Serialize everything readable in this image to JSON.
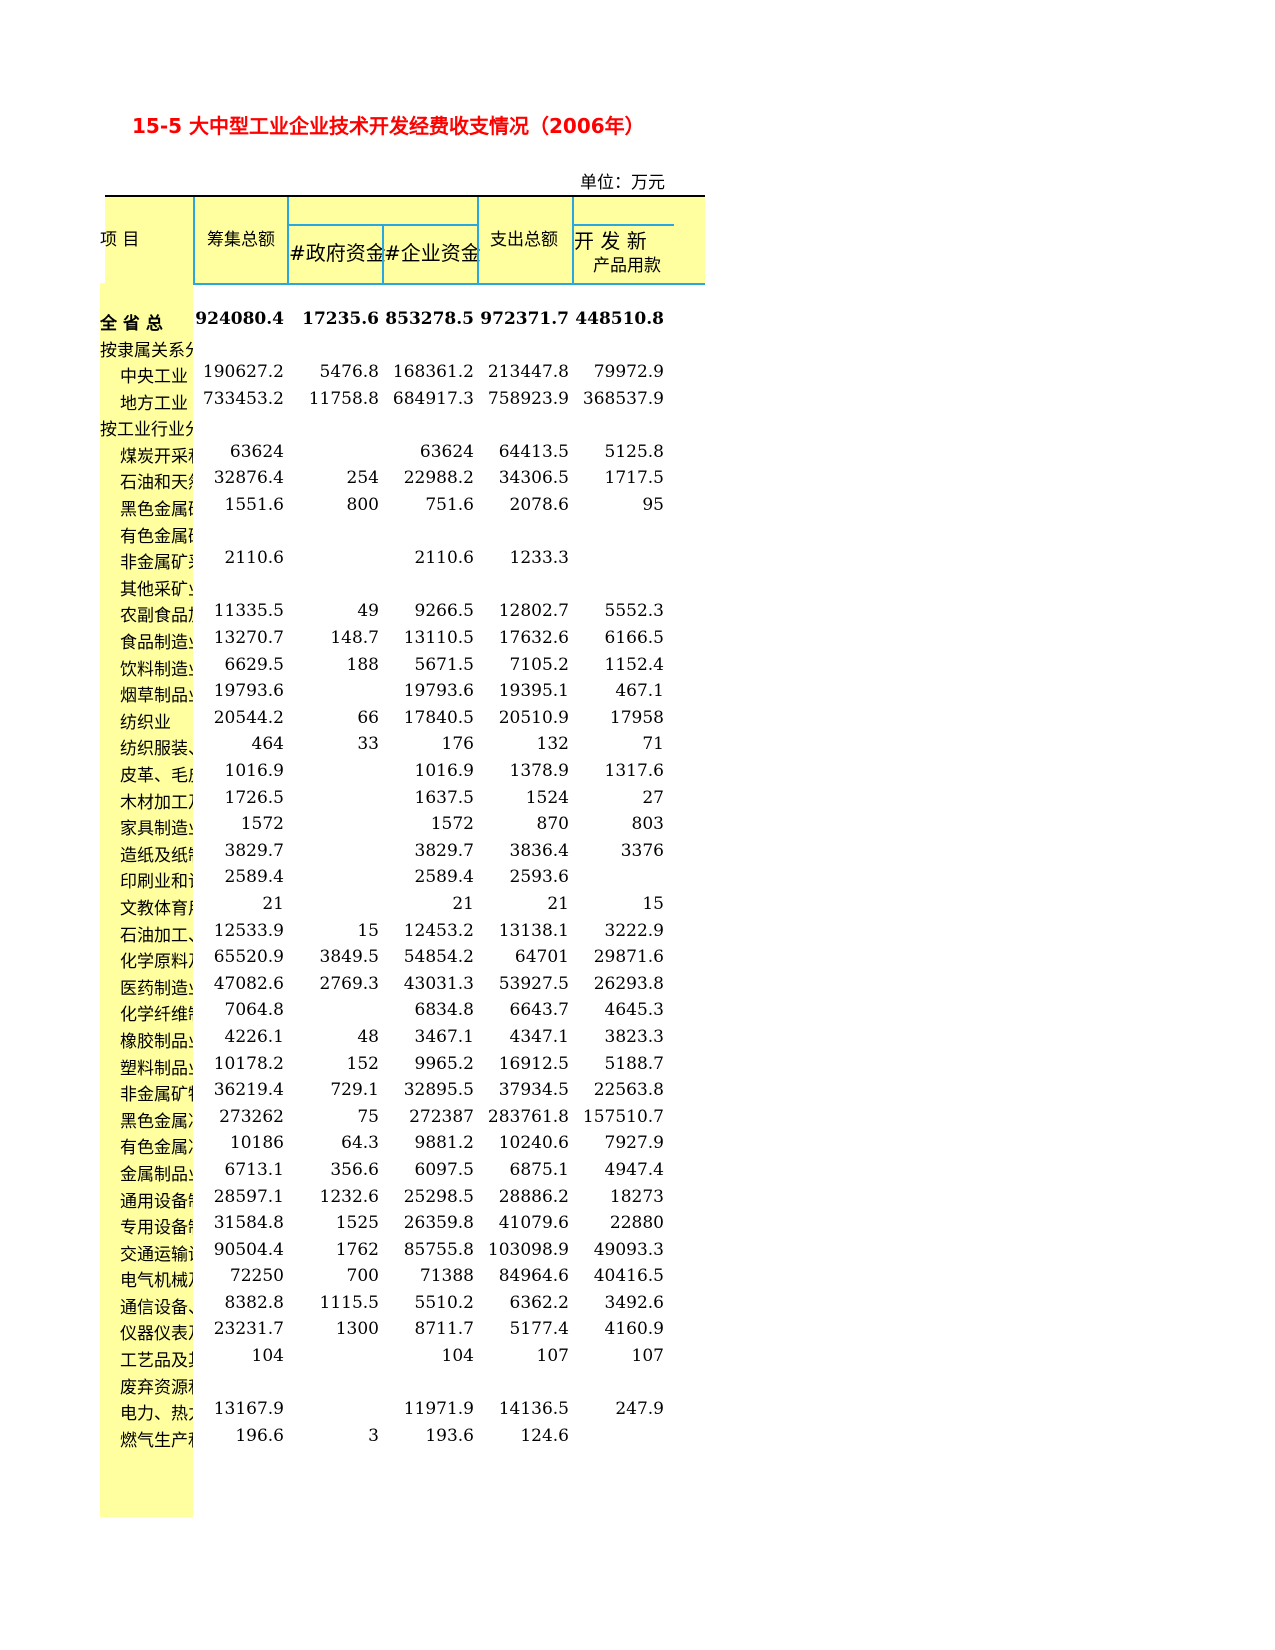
{
  "title": "15-5 大中型工业企业技术开发经费收支情况（2006年）",
  "unit": "单位：万元",
  "header": {
    "item": "项      目",
    "raise_total": "筹集总额",
    "gov_fund": "#政府资金",
    "enterprise_fund": "#企业资金",
    "spend_total": "支出总额",
    "new_product_top": "开   发   新",
    "new_product_bottom": "产品用款"
  },
  "rows": [
    {
      "label": "全   省   总",
      "v1": "924080.4",
      "v2": "17235.6",
      "v3": "853278.5",
      "v4": "972371.7",
      "v5": "448510.8",
      "bold": true
    },
    {
      "label": "按隶属关系分",
      "v1": "",
      "v2": "",
      "v3": "",
      "v4": "",
      "v5": ""
    },
    {
      "label": "中央工业",
      "v1": "190627.2",
      "v2": "5476.8",
      "v3": "168361.2",
      "v4": "213447.8",
      "v5": "79972.9",
      "indent": true
    },
    {
      "label": "地方工业",
      "v1": "733453.2",
      "v2": "11758.8",
      "v3": "684917.3",
      "v4": "758923.9",
      "v5": "368537.9",
      "indent": true
    },
    {
      "label": "按工业行业分",
      "v1": "",
      "v2": "",
      "v3": "",
      "v4": "",
      "v5": ""
    },
    {
      "label": "煤炭开采和洗选业",
      "v1": "63624",
      "v2": "",
      "v3": "63624",
      "v4": "64413.5",
      "v5": "5125.8",
      "indent": true
    },
    {
      "label": "石油和天然气开采业",
      "v1": "32876.4",
      "v2": "254",
      "v3": "22988.2",
      "v4": "34306.5",
      "v5": "1717.5",
      "indent": true
    },
    {
      "label": "黑色金属矿采选业",
      "v1": "1551.6",
      "v2": "800",
      "v3": "751.6",
      "v4": "2078.6",
      "v5": "95",
      "indent": true
    },
    {
      "label": "有色金属矿采选业",
      "v1": "",
      "v2": "",
      "v3": "",
      "v4": "",
      "v5": "",
      "indent": true
    },
    {
      "label": "非金属矿采选业",
      "v1": "2110.6",
      "v2": "",
      "v3": "2110.6",
      "v4": "1233.3",
      "v5": "",
      "indent": true
    },
    {
      "label": "其他采矿业",
      "v1": "",
      "v2": "",
      "v3": "",
      "v4": "",
      "v5": "",
      "indent": true
    },
    {
      "label": "农副食品加工业",
      "v1": "11335.5",
      "v2": "49",
      "v3": "9266.5",
      "v4": "12802.7",
      "v5": "5552.3",
      "indent": true
    },
    {
      "label": "食品制造业",
      "v1": "13270.7",
      "v2": "148.7",
      "v3": "13110.5",
      "v4": "17632.6",
      "v5": "6166.5",
      "indent": true
    },
    {
      "label": "饮料制造业",
      "v1": "6629.5",
      "v2": "188",
      "v3": "5671.5",
      "v4": "7105.2",
      "v5": "1152.4",
      "indent": true
    },
    {
      "label": "烟草制品业",
      "v1": "19793.6",
      "v2": "",
      "v3": "19793.6",
      "v4": "19395.1",
      "v5": "467.1",
      "indent": true
    },
    {
      "label": "纺织业",
      "v1": "20544.2",
      "v2": "66",
      "v3": "17840.5",
      "v4": "20510.9",
      "v5": "17958",
      "indent": true
    },
    {
      "label": "纺织服装、鞋、帽制造业",
      "v1": "464",
      "v2": "33",
      "v3": "176",
      "v4": "132",
      "v5": "71",
      "indent": true
    },
    {
      "label": "皮革、毛皮、羽毛及其制品业",
      "v1": "1016.9",
      "v2": "",
      "v3": "1016.9",
      "v4": "1378.9",
      "v5": "1317.6",
      "indent": true
    },
    {
      "label": "木材加工及木、竹、藤制品业",
      "v1": "1726.5",
      "v2": "",
      "v3": "1637.5",
      "v4": "1524",
      "v5": "27",
      "indent": true
    },
    {
      "label": "家具制造业",
      "v1": "1572",
      "v2": "",
      "v3": "1572",
      "v4": "870",
      "v5": "803",
      "indent": true
    },
    {
      "label": "造纸及纸制品业",
      "v1": "3829.7",
      "v2": "",
      "v3": "3829.7",
      "v4": "3836.4",
      "v5": "3376",
      "indent": true
    },
    {
      "label": "印刷业和记录媒介的复制",
      "v1": "2589.4",
      "v2": "",
      "v3": "2589.4",
      "v4": "2593.6",
      "v5": "",
      "indent": true
    },
    {
      "label": "文教体育用品制造业",
      "v1": "21",
      "v2": "",
      "v3": "21",
      "v4": "21",
      "v5": "15",
      "indent": true
    },
    {
      "label": "石油加工、炼焦及核燃料加工业",
      "v1": "12533.9",
      "v2": "15",
      "v3": "12453.2",
      "v4": "13138.1",
      "v5": "3222.9",
      "indent": true
    },
    {
      "label": "化学原料及化学制品制造业",
      "v1": "65520.9",
      "v2": "3849.5",
      "v3": "54854.2",
      "v4": "64701",
      "v5": "29871.6",
      "indent": true
    },
    {
      "label": "医药制造业",
      "v1": "47082.6",
      "v2": "2769.3",
      "v3": "43031.3",
      "v4": "53927.5",
      "v5": "26293.8",
      "indent": true
    },
    {
      "label": "化学纤维制造业",
      "v1": "7064.8",
      "v2": "",
      "v3": "6834.8",
      "v4": "6643.7",
      "v5": "4645.3",
      "indent": true
    },
    {
      "label": "橡胶制品业",
      "v1": "4226.1",
      "v2": "48",
      "v3": "3467.1",
      "v4": "4347.1",
      "v5": "3823.3",
      "indent": true
    },
    {
      "label": "塑料制品业",
      "v1": "10178.2",
      "v2": "152",
      "v3": "9965.2",
      "v4": "16912.5",
      "v5": "5188.7",
      "indent": true
    },
    {
      "label": "非金属矿物制品业",
      "v1": "36219.4",
      "v2": "729.1",
      "v3": "32895.5",
      "v4": "37934.5",
      "v5": "22563.8",
      "indent": true
    },
    {
      "label": "黑色金属冶炼及压延加工业",
      "v1": "273262",
      "v2": "75",
      "v3": "272387",
      "v4": "283761.8",
      "v5": "157510.7",
      "indent": true
    },
    {
      "label": "有色金属冶炼及压延加工业",
      "v1": "10186",
      "v2": "64.3",
      "v3": "9881.2",
      "v4": "10240.6",
      "v5": "7927.9",
      "indent": true
    },
    {
      "label": "金属制品业",
      "v1": "6713.1",
      "v2": "356.6",
      "v3": "6097.5",
      "v4": "6875.1",
      "v5": "4947.4",
      "indent": true
    },
    {
      "label": "通用设备制造业",
      "v1": "28597.1",
      "v2": "1232.6",
      "v3": "25298.5",
      "v4": "28886.2",
      "v5": "18273",
      "indent": true
    },
    {
      "label": "专用设备制造业",
      "v1": "31584.8",
      "v2": "1525",
      "v3": "26359.8",
      "v4": "41079.6",
      "v5": "22880",
      "indent": true
    },
    {
      "label": "交通运输设备制造业",
      "v1": "90504.4",
      "v2": "1762",
      "v3": "85755.8",
      "v4": "103098.9",
      "v5": "49093.3",
      "indent": true
    },
    {
      "label": "电气机械及器材制造业",
      "v1": "72250",
      "v2": "700",
      "v3": "71388",
      "v4": "84964.6",
      "v5": "40416.5",
      "indent": true
    },
    {
      "label": "通信设备、计算机及其他电子设备制造业",
      "v1": "8382.8",
      "v2": "1115.5",
      "v3": "5510.2",
      "v4": "6362.2",
      "v5": "3492.6",
      "indent": true
    },
    {
      "label": "仪器仪表及文化、办公用机械制造业",
      "v1": "23231.7",
      "v2": "1300",
      "v3": "8711.7",
      "v4": "5177.4",
      "v5": "4160.9",
      "indent": true
    },
    {
      "label": "工艺品及其他制造业",
      "v1": "104",
      "v2": "",
      "v3": "104",
      "v4": "107",
      "v5": "107",
      "indent": true
    },
    {
      "label": "废弃资源和废旧材料回收加工业",
      "v1": "",
      "v2": "",
      "v3": "",
      "v4": "",
      "v5": "",
      "indent": true
    },
    {
      "label": "电力、热力的生产和供应业",
      "v1": "13167.9",
      "v2": "",
      "v3": "11971.9",
      "v4": "14136.5",
      "v5": "247.9",
      "indent": true
    },
    {
      "label": "燃气生产和供应业",
      "v1": "196.6",
      "v2": "3",
      "v3": "193.6",
      "v4": "124.6",
      "v5": "",
      "indent": true
    }
  ]
}
